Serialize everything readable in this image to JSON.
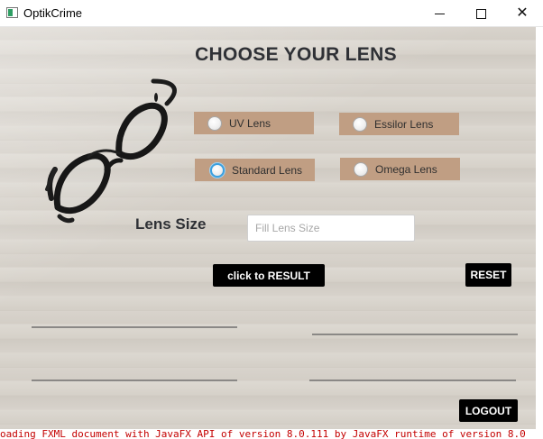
{
  "window": {
    "title": "OptikCrime",
    "minimize_icon": "minimize-icon",
    "maximize_icon": "maximize-icon",
    "close_icon": "close-icon",
    "close_glyph": "✕"
  },
  "main": {
    "heading": "CHOOSE YOUR LENS",
    "lens_options": [
      {
        "label": "UV Lens",
        "selected": false,
        "focused": false
      },
      {
        "label": "Essilor Lens",
        "selected": false,
        "focused": false
      },
      {
        "label": "Standard Lens",
        "selected": false,
        "focused": true
      },
      {
        "label": "Omega Lens",
        "selected": false,
        "focused": false
      }
    ],
    "lens_size_label": "Lens Size",
    "lens_size_value": "",
    "lens_size_placeholder": "Fill Lens Size",
    "result_button": "click to RESULT",
    "reset_button": "RESET",
    "logout_button": "LOGOUT"
  },
  "console": {
    "text": "oading FXML document with JavaFX API of version 8.0.111 by JavaFX runtime of version 8.0"
  },
  "colors": {
    "radio_box": "#c09e83",
    "button_bg": "#000000",
    "button_text": "#ffffff",
    "heading": "#2f3136",
    "console_text": "#c40000"
  }
}
